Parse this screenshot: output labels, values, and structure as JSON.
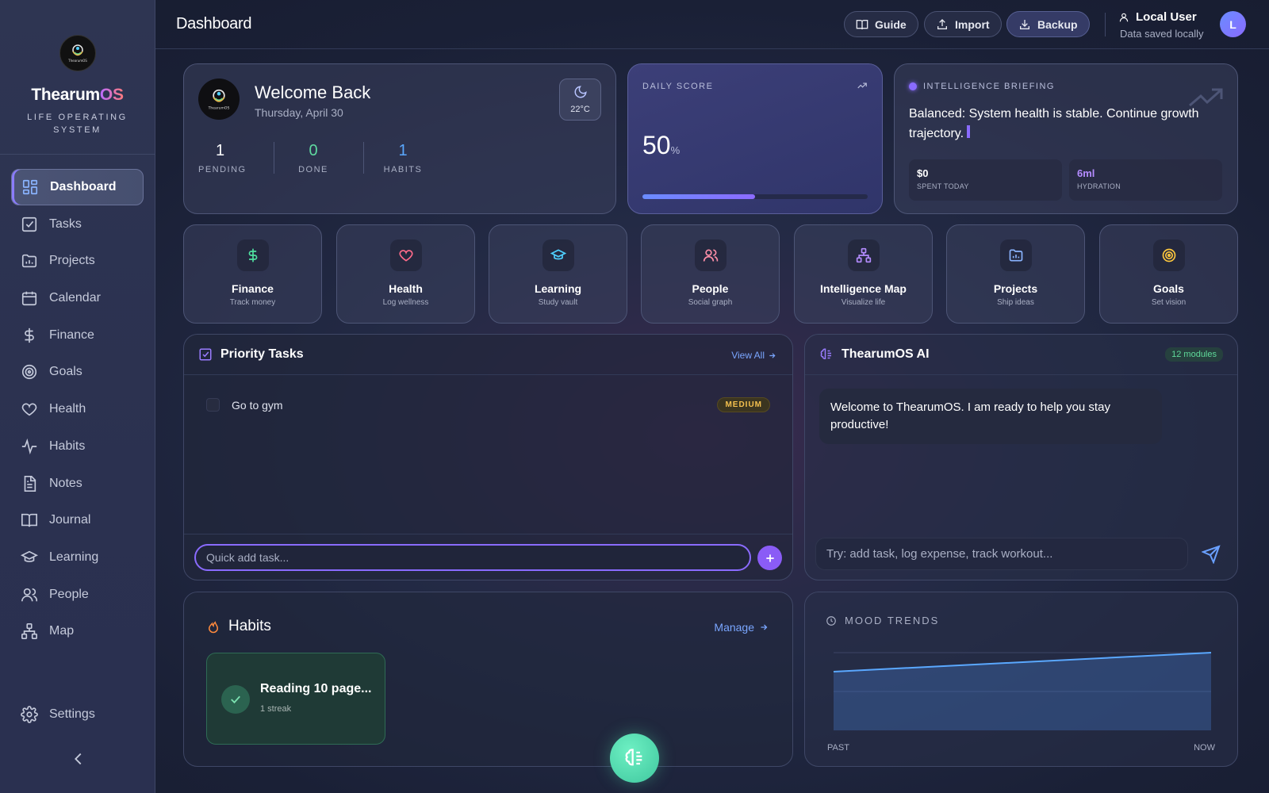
{
  "app": {
    "brand_main": "Thearum",
    "brand_suffix": "OS",
    "tagline": "LIFE OPERATING SYSTEM",
    "logo_text": "ThearumOS"
  },
  "sidebar": {
    "items": [
      {
        "label": "Dashboard",
        "icon": "dashboard-icon",
        "active": true
      },
      {
        "label": "Tasks",
        "icon": "checkbox-icon"
      },
      {
        "label": "Projects",
        "icon": "folder-icon"
      },
      {
        "label": "Calendar",
        "icon": "calendar-icon"
      },
      {
        "label": "Finance",
        "icon": "dollar-icon"
      },
      {
        "label": "Goals",
        "icon": "target-icon"
      },
      {
        "label": "Health",
        "icon": "heart-icon"
      },
      {
        "label": "Habits",
        "icon": "activity-icon"
      },
      {
        "label": "Notes",
        "icon": "notes-icon"
      },
      {
        "label": "Journal",
        "icon": "book-icon"
      },
      {
        "label": "Learning",
        "icon": "graduation-cap-icon"
      },
      {
        "label": "People",
        "icon": "people-icon"
      },
      {
        "label": "Map",
        "icon": "network-icon"
      }
    ],
    "settings_label": "Settings"
  },
  "header": {
    "title": "Dashboard",
    "guide": "Guide",
    "import": "Import",
    "backup": "Backup",
    "user_name": "Local User",
    "user_status": "Data saved locally",
    "avatar_initial": "L"
  },
  "welcome": {
    "title": "Welcome Back",
    "date": "Thursday, April 30",
    "temperature": "22°C",
    "stats": [
      {
        "value": "1",
        "label": "PENDING",
        "color": "#ffffff"
      },
      {
        "value": "0",
        "label": "DONE",
        "color": "#5fd9a0"
      },
      {
        "value": "1",
        "label": "HABITS",
        "color": "#5aa8ff"
      }
    ]
  },
  "daily_score": {
    "label": "DAILY SCORE",
    "value": "50",
    "unit": "%",
    "progress": 0.5
  },
  "intelligence": {
    "label": "INTELLIGENCE BRIEFING",
    "message": "Balanced: System health is stable. Continue growth trajectory.",
    "spent_value": "$0",
    "spent_label": "SPENT TODAY",
    "hydration_value": "6ml",
    "hydration_label": "HYDRATION",
    "hydration_color": "#b48cff"
  },
  "modules": [
    {
      "title": "Finance",
      "subtitle": "Track money",
      "icon": "dollar-icon",
      "color": "#4fe0a0"
    },
    {
      "title": "Health",
      "subtitle": "Log wellness",
      "icon": "heart-icon",
      "color": "#ff6b8a"
    },
    {
      "title": "Learning",
      "subtitle": "Study vault",
      "icon": "graduation-cap-icon",
      "color": "#4fd0ff"
    },
    {
      "title": "People",
      "subtitle": "Social graph",
      "icon": "people-icon",
      "color": "#ff8fa8"
    },
    {
      "title": "Intelligence Map",
      "subtitle": "Visualize life",
      "icon": "network-icon",
      "color": "#b48cff"
    },
    {
      "title": "Projects",
      "subtitle": "Ship ideas",
      "icon": "folder-icon",
      "color": "#8ab4ff"
    },
    {
      "title": "Goals",
      "subtitle": "Set vision",
      "icon": "target-icon",
      "color": "#ffc83d"
    }
  ],
  "priority_tasks": {
    "title": "Priority Tasks",
    "view_all": "View All",
    "tasks": [
      {
        "name": "Go to gym",
        "priority": "MEDIUM"
      }
    ],
    "quick_add_placeholder": "Quick add task..."
  },
  "ai": {
    "title": "ThearumOS AI",
    "modules_badge": "12 modules",
    "welcome_message": "Welcome to ThearumOS. I am ready to help you stay productive!",
    "input_placeholder": "Try: add task, log expense, track workout..."
  },
  "habits": {
    "title": "Habits",
    "manage": "Manage",
    "items": [
      {
        "name": "Reading 10 page...",
        "streak": "1 streak"
      }
    ]
  },
  "mood": {
    "label": "MOOD TRENDS",
    "start_label": "PAST",
    "end_label": "NOW"
  }
}
